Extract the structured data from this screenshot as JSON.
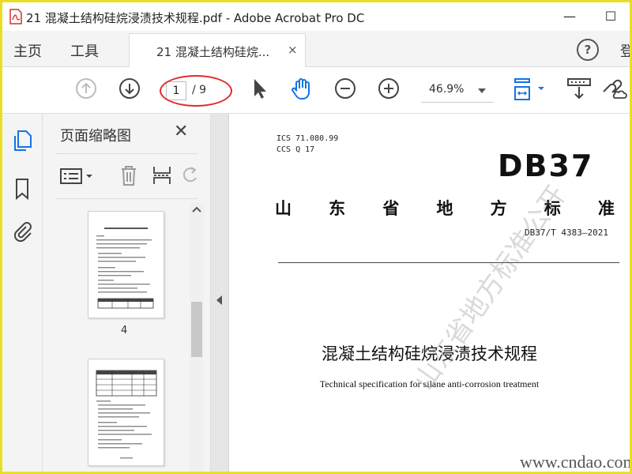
{
  "window": {
    "title": "21 混凝土结构硅烷浸渍技术规程.pdf - Adobe Acrobat Pro DC",
    "minimize": "—",
    "maximize": "☐"
  },
  "tabbar": {
    "home": "主页",
    "tools": "工具",
    "doc_tab": "21 混凝土结构硅烷...",
    "doc_tab_close": "×",
    "help": "?",
    "cut_text": "登"
  },
  "toolbar": {
    "current_page": "1",
    "total_pages": "/ 9",
    "zoom": "46.9%"
  },
  "panel": {
    "title": "页面缩略图",
    "close": "✕",
    "thumbnails": [
      {
        "page_number": "4"
      },
      {
        "page_number": ""
      }
    ]
  },
  "document": {
    "ics": "ICS  71.080.99",
    "ccs": "CCS  Q 17",
    "code": "DB37",
    "standard_chars": [
      "山",
      "东",
      "省",
      "地",
      "方",
      "标",
      "准"
    ],
    "standard_number": "DB37/T 4383—2021",
    "title_cn": "混凝土结构硅烷浸渍技术规程",
    "title_en": "Technical specification for silane anti-corrosion treatment",
    "watermark_diag": "山东省地方标准公开",
    "watermark_site": "www.cndao.com"
  },
  "colors": {
    "frame_border": "#e8df24",
    "ellipse_highlight": "#e12a2a",
    "acrobat_blue": "#1473e6"
  }
}
